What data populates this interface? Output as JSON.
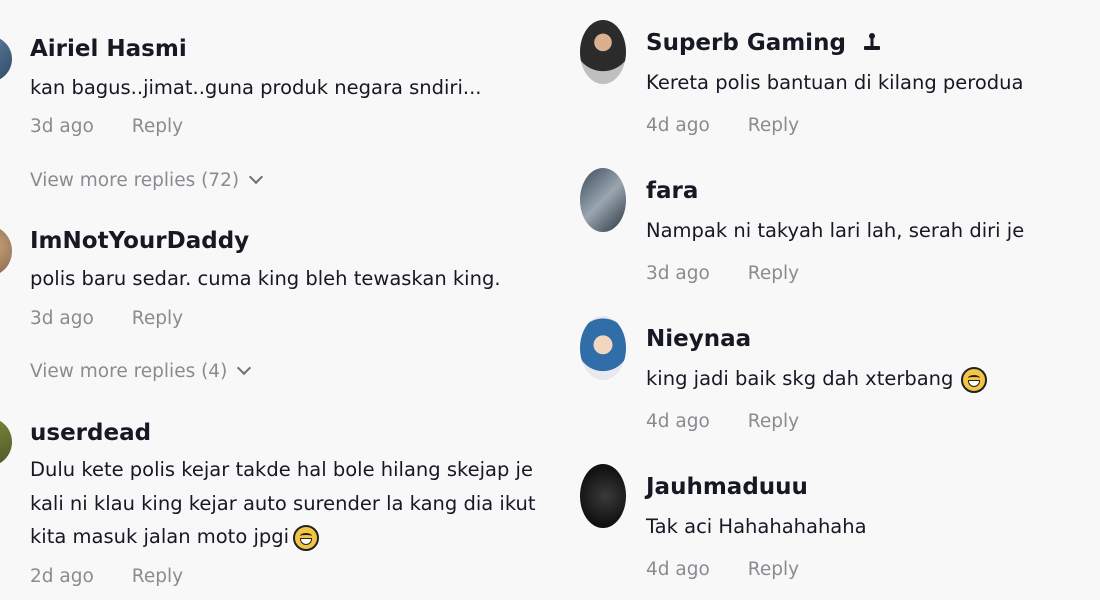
{
  "left_comments": [
    {
      "username": "Airiel Hasmi",
      "text": [
        "kan bagus..jimat..guna produk negara sndiri..."
      ],
      "time": "3d ago",
      "reply": "Reply",
      "more_replies": "View more replies (72)"
    },
    {
      "username": "ImNotYourDaddy",
      "text": [
        "polis baru sedar. cuma king bleh tewaskan king."
      ],
      "time": "3d ago",
      "reply": "Reply",
      "more_replies": "View more replies (4)"
    },
    {
      "username": "userdead",
      "text": [
        "Dulu kete polis kejar takde hal bole hilang skejap je",
        "kali ni klau king kejar auto surender la kang dia ikut",
        "kita masuk jalan moto jpgi"
      ],
      "time": "2d ago",
      "reply": "Reply"
    }
  ],
  "right_comments": [
    {
      "username": "Superb Gaming",
      "text": [
        "Kereta polis bantuan di kilang perodua"
      ],
      "time": "4d ago",
      "reply": "Reply"
    },
    {
      "username": "fara",
      "text": [
        "Nampak ni takyah lari lah, serah diri je"
      ],
      "time": "3d ago",
      "reply": "Reply"
    },
    {
      "username": "Nieynaa",
      "text": [
        "king jadi baik skg dah xterbang"
      ],
      "time": "4d ago",
      "reply": "Reply"
    },
    {
      "username": "Jauhmaduuu",
      "text": [
        "Tak aci Hahahahahaha"
      ],
      "time": "4d ago",
      "reply": "Reply"
    }
  ],
  "icons": {
    "badge": "joystick-icon",
    "emoji_rofl": "rolling-laughing-emoji-icon",
    "emoji_grin": "grinning-sweat-emoji-icon",
    "chevron": "chevron-down-icon"
  },
  "colors": {
    "background": "#f8f8f8",
    "name": "#161823",
    "meta": "#8a8b91"
  }
}
